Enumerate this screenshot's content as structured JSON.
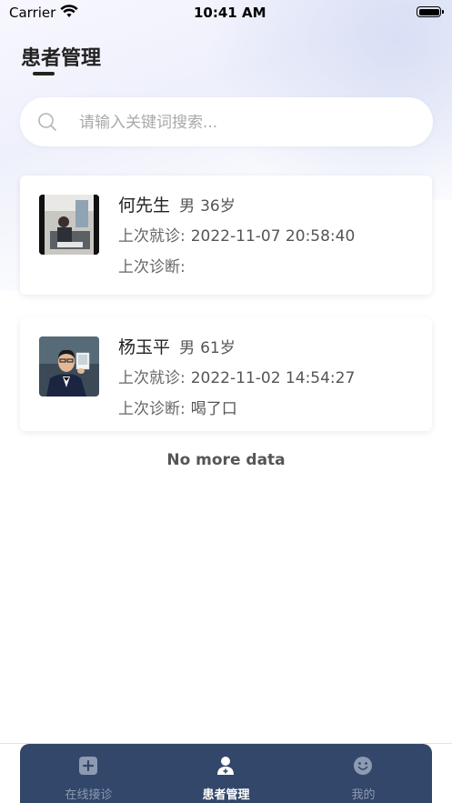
{
  "status_bar": {
    "carrier": "Carrier",
    "time": "10:41 AM"
  },
  "header": {
    "title": "患者管理"
  },
  "search": {
    "placeholder": "请输入关键词搜索...",
    "value": ""
  },
  "patient_fields": {
    "last_visit_label": "上次就诊:",
    "last_diagnosis_label": "上次诊断:"
  },
  "patients": [
    {
      "name": "何先生",
      "sex": "男",
      "age": "36岁",
      "last_visit": "2022-11-07 20:58:40",
      "last_diagnosis": ""
    },
    {
      "name": "杨玉平",
      "sex": "男",
      "age": "61岁",
      "last_visit": "2022-11-02 14:54:27",
      "last_diagnosis": "喝了口"
    }
  ],
  "list_footer": "No more data",
  "tab_bar": {
    "tabs": [
      {
        "label": "在线接诊",
        "icon": "plus-square-icon",
        "active": false
      },
      {
        "label": "患者管理",
        "icon": "patient-user-icon",
        "active": true
      },
      {
        "label": "我的",
        "icon": "smiley-icon",
        "active": false
      }
    ]
  },
  "colors": {
    "tab_bar_bg": "#33476a",
    "tab_inactive": "#8d9ab2",
    "tab_active": "#ffffff"
  }
}
